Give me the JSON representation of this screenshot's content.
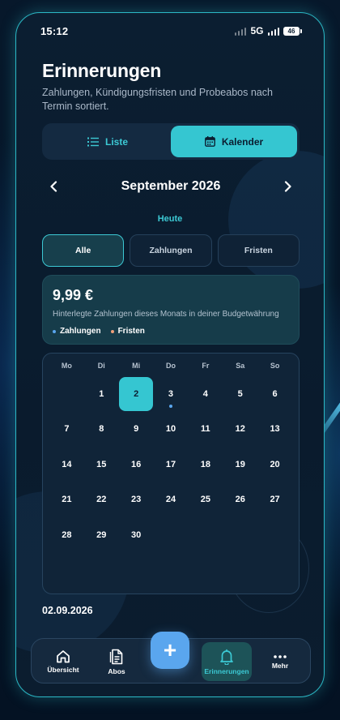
{
  "status_bar": {
    "time": "15:12",
    "network": "5G",
    "battery": "46"
  },
  "header": {
    "title": "Erinnerungen",
    "subtitle": "Zahlungen, Kündigungsfristen und Probeabos nach Termin sortiert."
  },
  "view_toggle": {
    "list_label": "Liste",
    "calendar_label": "Kalender",
    "active": "calendar"
  },
  "month_nav": {
    "label": "September 2026",
    "prev_icon": "chevron-left-icon",
    "next_icon": "chevron-right-icon"
  },
  "today_label": "Heute",
  "filters": [
    {
      "label": "Alle",
      "selected": true
    },
    {
      "label": "Zahlungen",
      "selected": false
    },
    {
      "label": "Fristen",
      "selected": false
    }
  ],
  "summary": {
    "amount": "9,99 €",
    "description": "Hinterlegte Zahlungen dieses Monats in deiner Budgetwährung",
    "legend": [
      {
        "label": "Zahlungen",
        "color": "#5aa6ee"
      },
      {
        "label": "Fristen",
        "color": "#f0a07a"
      }
    ]
  },
  "calendar": {
    "weekdays": [
      "Mo",
      "Di",
      "Mi",
      "Do",
      "Fr",
      "Sa",
      "So"
    ],
    "leading_blanks": 1,
    "days": [
      "1",
      "2",
      "3",
      "4",
      "5",
      "6",
      "7",
      "8",
      "9",
      "10",
      "11",
      "12",
      "13",
      "14",
      "15",
      "16",
      "17",
      "18",
      "19",
      "20",
      "21",
      "22",
      "23",
      "24",
      "25",
      "26",
      "27",
      "28",
      "29",
      "30"
    ],
    "selected_day": "2",
    "payment_dot_days": [
      "3"
    ]
  },
  "selected_date": "02.09.2026",
  "bottom_nav": {
    "items": [
      {
        "label": "Übersicht",
        "icon": "home-icon",
        "active": false
      },
      {
        "label": "Abos",
        "icon": "document-icon",
        "active": false
      },
      {
        "label": "Erinnerungen",
        "icon": "bell-icon",
        "active": true
      },
      {
        "label": "Mehr",
        "icon": "more-dots-icon",
        "active": false
      }
    ],
    "fab_label": "+"
  },
  "colors": {
    "accent": "#35c6d1",
    "fab": "#5aa6ee",
    "payment_dot": "#5aa6ee",
    "deadline_dot": "#f0a07a"
  }
}
